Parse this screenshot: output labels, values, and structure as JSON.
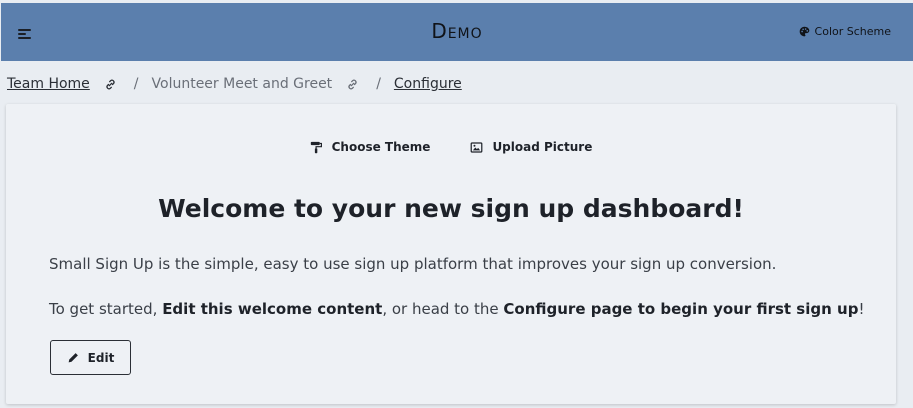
{
  "header": {
    "title": "Demo",
    "color_scheme_label": "Color Scheme",
    "background": "#5b7fad"
  },
  "breadcrumb": {
    "items": [
      {
        "label": "Team Home"
      },
      {
        "label": "Volunteer Meet and Greet"
      },
      {
        "label": "Configure"
      }
    ],
    "separator": "/"
  },
  "toolbar": {
    "choose_theme_label": "Choose Theme",
    "upload_picture_label": "Upload Picture"
  },
  "welcome": {
    "title": "Welcome to your new sign up dashboard!",
    "paragraph1": "Small Sign Up is the simple, easy to use sign up platform that improves your sign up conversion.",
    "p2_prefix": "To get started, ",
    "p2_bold1": "Edit this welcome content",
    "p2_middle": ", or head to the ",
    "p2_bold2": "Configure page to begin your first sign up",
    "p2_suffix": "!",
    "edit_label": "Edit"
  },
  "icons": {
    "menu": "menu-icon",
    "palette": "palette-icon",
    "link": "link-icon",
    "paint_roller": "paint-roller-icon",
    "image": "image-icon",
    "pencil": "pencil-icon"
  }
}
